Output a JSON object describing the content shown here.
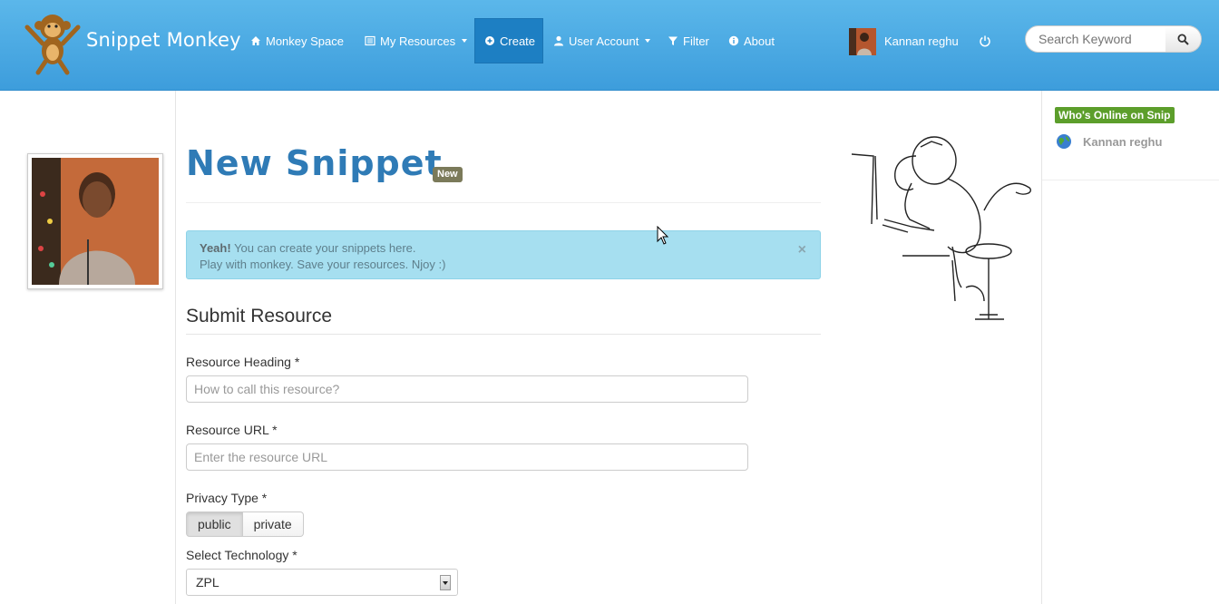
{
  "navbar": {
    "brand": "Snippet Monkey",
    "items": [
      {
        "label": "Monkey Space",
        "icon": "home-icon"
      },
      {
        "label": "My Resources",
        "icon": "list-icon",
        "dropdown": true
      },
      {
        "label": "Create",
        "icon": "plus-circle-icon",
        "active": true
      },
      {
        "label": "User Account",
        "icon": "user-icon",
        "dropdown": true
      },
      {
        "label": "Filter",
        "icon": "filter-icon"
      },
      {
        "label": "About",
        "icon": "info-icon"
      }
    ],
    "user_name": "Kannan reghu",
    "search_placeholder": "Search Keyword"
  },
  "main": {
    "title": "New Snippet",
    "badge": "New",
    "alert": {
      "strong": "Yeah!",
      "line1": " You can create your snippets here.",
      "line2": "Play with monkey. Save your resources. Njoy :)",
      "close": "×"
    },
    "section_title": "Submit Resource",
    "form": {
      "heading_label": "Resource Heading *",
      "heading_placeholder": "How to call this resource?",
      "url_label": "Resource URL *",
      "url_placeholder": "Enter the resource URL",
      "privacy_label": "Privacy Type *",
      "privacy_options": [
        "public",
        "private"
      ],
      "privacy_selected": "public",
      "tech_label": "Select Technology *",
      "tech_value": "ZPL"
    }
  },
  "sidebar": {
    "online_label": "Who's Online on Snip",
    "online_users": [
      "Kannan reghu"
    ]
  },
  "colors": {
    "navbar": "#3d9ddc",
    "title": "#2f7bb6",
    "alert_bg": "#a6dff0",
    "online_badge": "#5c9e2b"
  }
}
